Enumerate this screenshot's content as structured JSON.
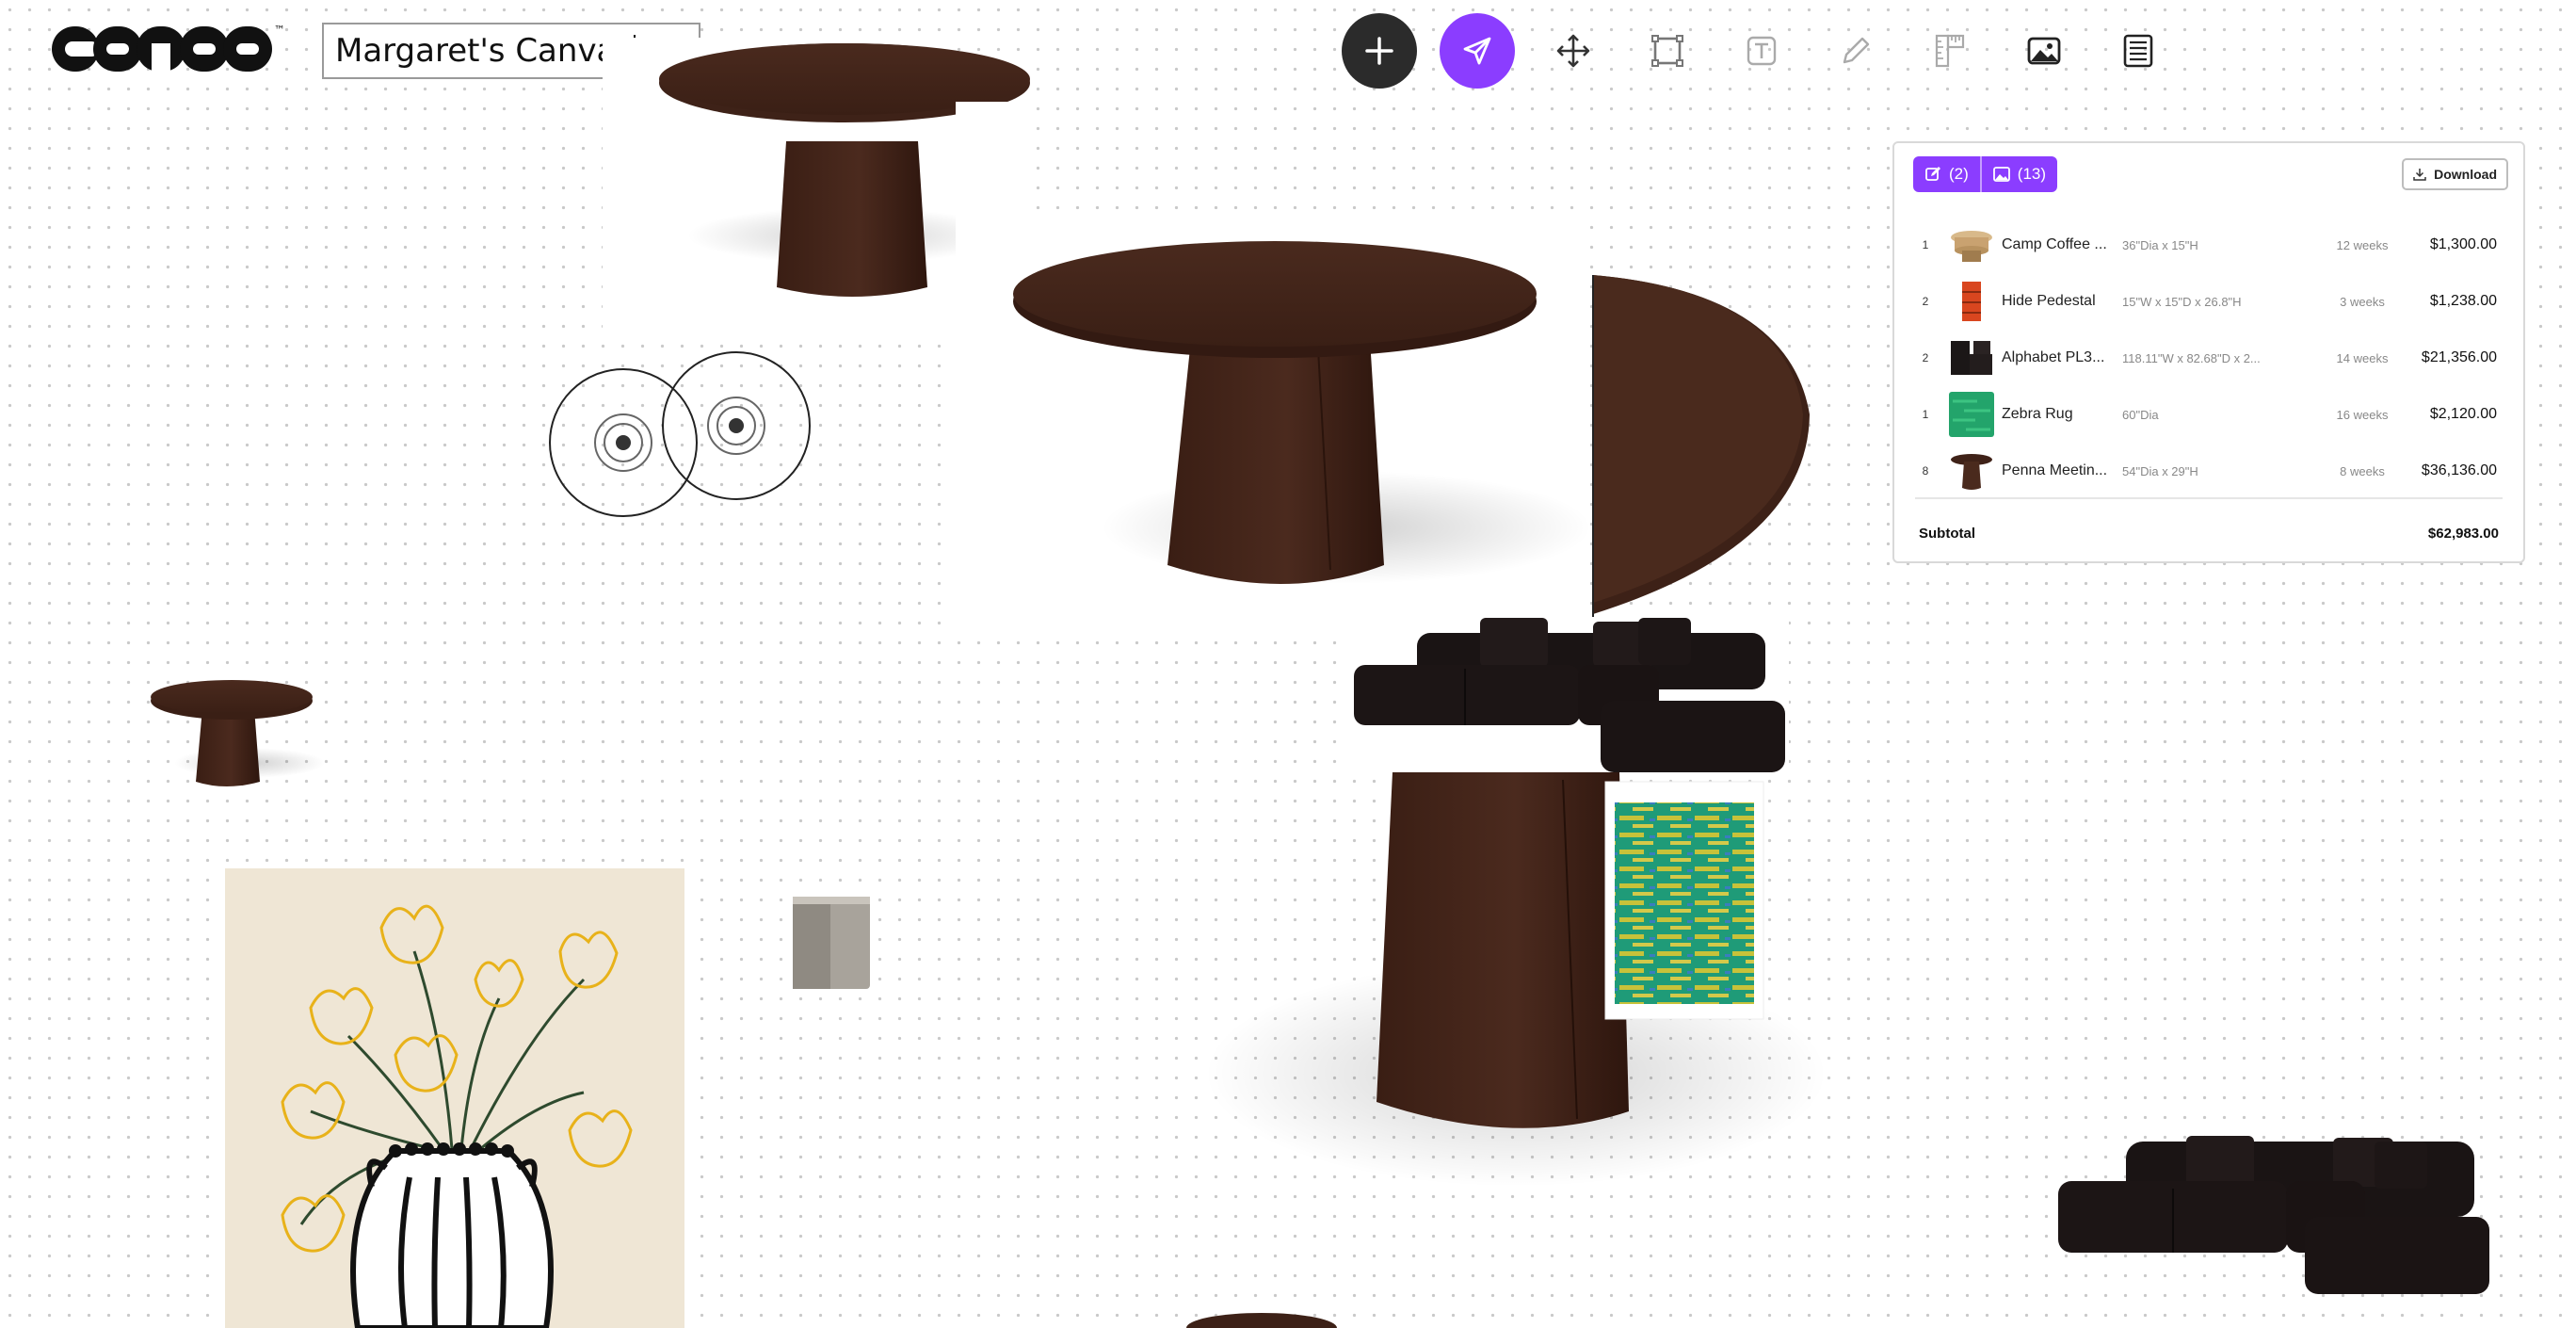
{
  "app": {
    "logo_text": "canoa"
  },
  "canvas": {
    "title": "Margaret's Canvas"
  },
  "toolbar": {
    "tools": [
      {
        "name": "add-icon"
      },
      {
        "name": "select-pointer-icon"
      },
      {
        "name": "move-icon"
      },
      {
        "name": "frame-icon"
      },
      {
        "name": "text-icon"
      },
      {
        "name": "pencil-icon"
      },
      {
        "name": "ruler-icon"
      },
      {
        "name": "image-icon"
      },
      {
        "name": "list-icon"
      }
    ],
    "accent_color": "#8b3dff",
    "dark_color": "#2b2b2b"
  },
  "panel": {
    "edit_count": "(2)",
    "image_count": "(13)",
    "download_label": "Download",
    "items": [
      {
        "qty": "1",
        "name": "Camp Coffee ...",
        "dims": "36\"Dia x 15\"H",
        "lead": "12 weeks",
        "price": "$1,300.00",
        "thumb": "coffee-table"
      },
      {
        "qty": "2",
        "name": "Hide Pedestal",
        "dims": "15\"W x 15\"D x 26.8\"H",
        "lead": "3 weeks",
        "price": "$1,238.00",
        "thumb": "orange-pedestal"
      },
      {
        "qty": "2",
        "name": "Alphabet PL3...",
        "dims": "118.11\"W x 82.68\"D x 2...",
        "lead": "14 weeks",
        "price": "$21,356.00",
        "thumb": "black-sofa"
      },
      {
        "qty": "1",
        "name": "Zebra Rug",
        "dims": "60\"Dia",
        "lead": "16 weeks",
        "price": "$2,120.00",
        "thumb": "green-rug"
      },
      {
        "qty": "8",
        "name": "Penna Meetin...",
        "dims": "54\"Dia x 29\"H",
        "lead": "8 weeks",
        "price": "$36,136.00",
        "thumb": "pedestal-table"
      }
    ],
    "subtotal_label": "Subtotal",
    "subtotal_value": "$62,983.00"
  }
}
